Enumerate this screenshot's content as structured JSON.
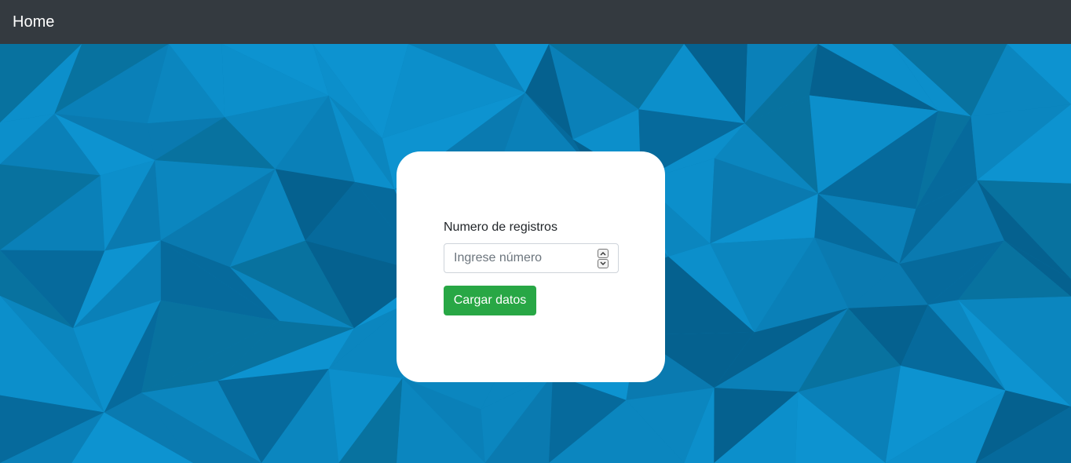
{
  "navbar": {
    "brand": "Home"
  },
  "form": {
    "label": "Numero de registros",
    "input_value": "",
    "input_placeholder": "Ingrese número",
    "submit_label": "Cargar datos"
  },
  "icons": {
    "spin_up": "chevron-up-icon",
    "spin_down": "chevron-down-icon"
  },
  "colors": {
    "navbar_bg": "#343a40",
    "background_blue": "#0a7fb5",
    "button_green": "#28a745",
    "card_bg": "#ffffff"
  }
}
